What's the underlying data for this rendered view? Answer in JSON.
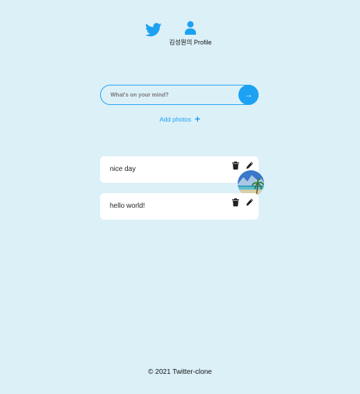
{
  "nav": {
    "home_icon": "twitter-bird-icon",
    "profile_icon": "user-icon",
    "profile_label": "김성원의 Profile"
  },
  "form": {
    "placeholder": "What's on your mind?",
    "submit_glyph": "→",
    "add_photos_label": "Add photos",
    "add_photos_glyph": "+"
  },
  "tweets": [
    {
      "text": "nice day",
      "has_photo": true
    },
    {
      "text": "hello world!",
      "has_photo": false
    }
  ],
  "footer": {
    "copyright": "© 2021 Twitter-clone"
  },
  "colors": {
    "background": "#dcf0f8",
    "accent": "#1da1f2",
    "card": "#ffffff"
  }
}
